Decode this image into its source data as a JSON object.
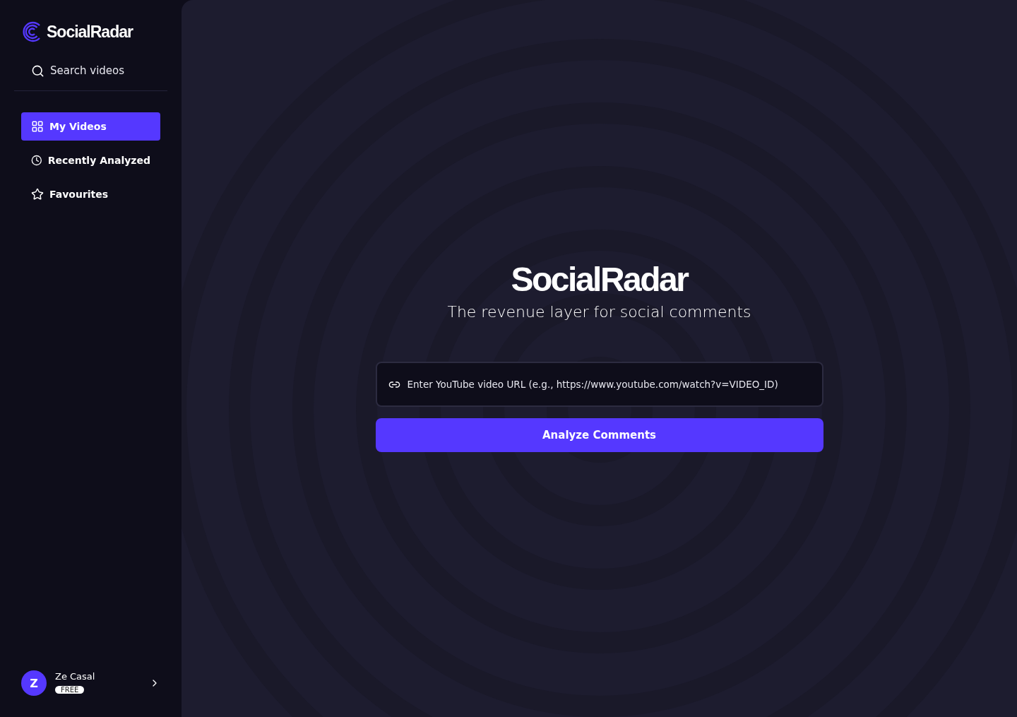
{
  "sidebar": {
    "brand": "SocialRadar",
    "search": {
      "placeholder": "Search videos"
    },
    "items": [
      {
        "label": "My Videos",
        "kind": "grid",
        "selected": true
      },
      {
        "label": "Recently Analyzed",
        "kind": "clock",
        "selected": false
      },
      {
        "label": "Favourites",
        "kind": "star",
        "selected": false
      }
    ],
    "user": {
      "initial": "Z",
      "name": "Ze Casal",
      "plan": "FREE"
    }
  },
  "main": {
    "title": "SocialRadar",
    "tagline": "The revenue layer for social comments",
    "url_field": {
      "placeholder": "Enter YouTube video URL (e.g., https://www.youtube.com/watch?v=VIDEO_ID)"
    },
    "button": "Analyze Comments"
  }
}
